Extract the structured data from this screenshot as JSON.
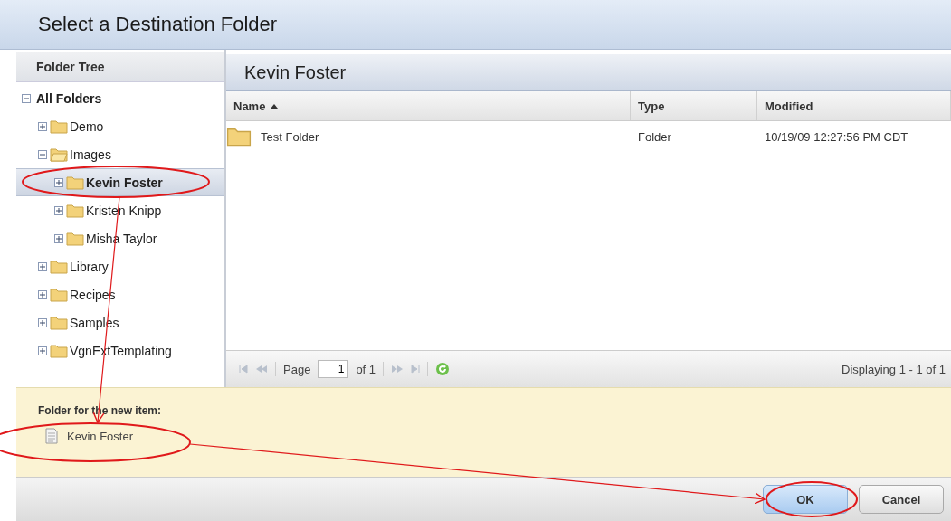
{
  "dialog": {
    "title": "Select a Destination Folder"
  },
  "tree": {
    "title": "Folder Tree",
    "items": [
      {
        "label": "All Folders",
        "expanded": true,
        "selected": false,
        "children": [
          {
            "label": "Demo",
            "expanded": false,
            "selected": false
          },
          {
            "label": "Images",
            "expanded": true,
            "selected": false,
            "children": [
              {
                "label": "Kevin Foster",
                "expanded": false,
                "selected": true
              },
              {
                "label": "Kristen Knipp",
                "expanded": false,
                "selected": false
              },
              {
                "label": "Misha Taylor",
                "expanded": false,
                "selected": false
              }
            ]
          },
          {
            "label": "Library",
            "expanded": false,
            "selected": false
          },
          {
            "label": "Recipes",
            "expanded": false,
            "selected": false
          },
          {
            "label": "Samples",
            "expanded": false,
            "selected": false
          },
          {
            "label": "VgnExtTemplating",
            "expanded": false,
            "selected": false
          }
        ]
      }
    ]
  },
  "grid": {
    "title": "Kevin Foster",
    "columns": [
      {
        "label": "Name",
        "sorted": true
      },
      {
        "label": "Type",
        "sorted": false
      },
      {
        "label": "Modified",
        "sorted": false
      }
    ],
    "rows": [
      {
        "name": "Test Folder",
        "type": "Folder",
        "modified": "10/19/09 12:27:56 PM CDT"
      }
    ]
  },
  "pager": {
    "page_label": "Page",
    "page": "1",
    "of": "of 1",
    "display": "Displaying 1 - 1 of 1"
  },
  "destination": {
    "label": "Folder for the new item:",
    "folder": "Kevin Foster"
  },
  "buttons": [
    {
      "label": "OK",
      "primary": true
    },
    {
      "label": "Cancel",
      "primary": false
    }
  ]
}
